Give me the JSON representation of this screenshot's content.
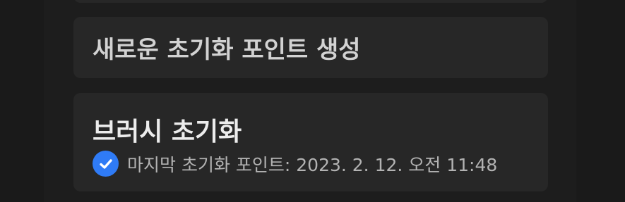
{
  "actions": {
    "create_reset_point_label": "새로운 초기화 포인트 생성"
  },
  "brush_reset": {
    "title": "브러시 초기화",
    "status_icon": "check-circle-icon",
    "last_reset_text": "마지막 초기화 포인트: 2023. 2. 12. 오전 11:48"
  },
  "colors": {
    "accent": "#2f7bf6",
    "card": "#272727",
    "background": "#1d1d1d"
  }
}
